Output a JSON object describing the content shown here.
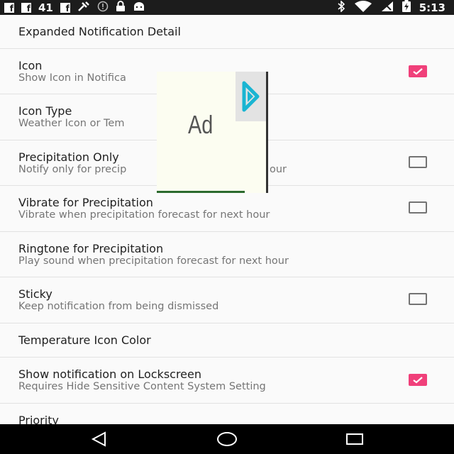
{
  "status_bar": {
    "notif_icons": [
      "facebook-icon",
      "facebook-icon",
      "facebook-icon",
      "tools-icon",
      "alert-icon",
      "lock-icon",
      "android-icon"
    ],
    "count_text": "41",
    "right_icons": [
      "bluetooth-icon",
      "wifi-icon",
      "signal-icon",
      "battery-charging-icon"
    ],
    "time": "5:13"
  },
  "preferences": {
    "header": "Expanded Notification Detail",
    "items": [
      {
        "title": "Icon",
        "summary": "Show Icon in Notifica",
        "checkbox": true,
        "checked": true
      },
      {
        "title": "Icon Type",
        "summary": "Weather Icon or Tem",
        "checkbox": false
      },
      {
        "title": "Precipitation Only",
        "summary": "Notify only for precip",
        "summary_tail": "our",
        "checkbox": true,
        "checked": false
      },
      {
        "title": "Vibrate for Precipitation",
        "summary": "Vibrate when precipitation forecast for next hour",
        "checkbox": true,
        "checked": false
      },
      {
        "title": "Ringtone for Precipitation",
        "summary": "Play sound when precipitation forecast for next hour",
        "checkbox": false
      },
      {
        "title": "Sticky",
        "summary": "Keep notification from being dismissed",
        "checkbox": true,
        "checked": false
      },
      {
        "title": "Temperature Icon Color",
        "checkbox": false
      },
      {
        "title": "Show notification on Lockscreen",
        "summary": "Requires Hide Sensitive Content System Setting",
        "checkbox": true,
        "checked": true
      },
      {
        "title": "Priority",
        "checkbox": false
      }
    ]
  },
  "ad": {
    "label": "Ad",
    "icon": "play-arrow-icon"
  },
  "nav_bar": {
    "buttons": [
      "back-icon",
      "home-icon",
      "recents-icon"
    ]
  },
  "colors": {
    "accent": "#f0407a",
    "status_bar": "#1c1c1c",
    "nav_bar": "#000000"
  }
}
